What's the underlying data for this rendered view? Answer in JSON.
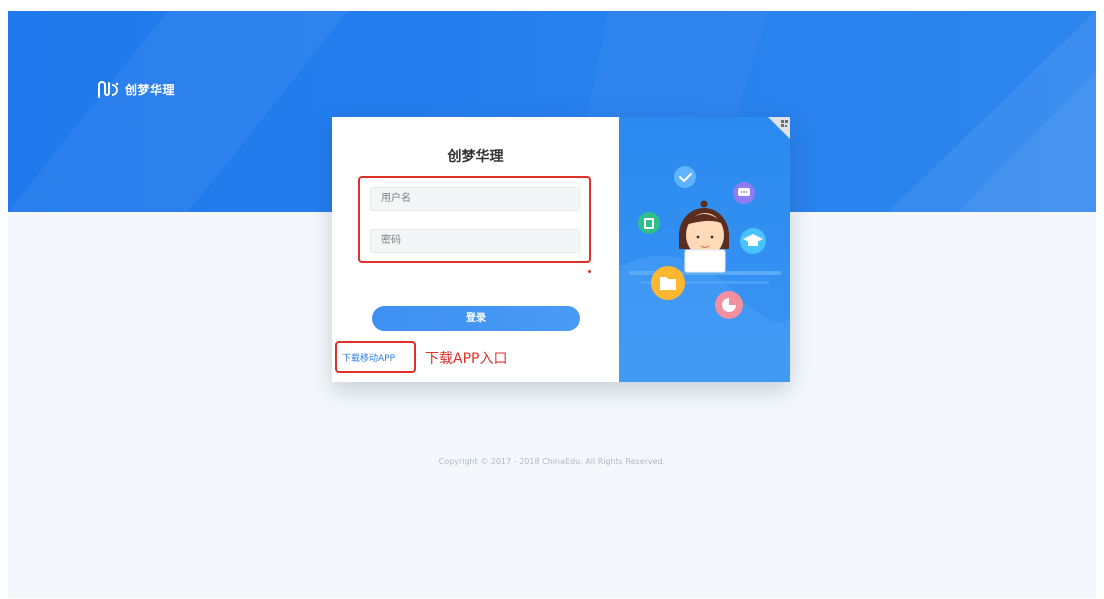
{
  "header": {
    "logo_text": "创梦华理",
    "logo_icon": "brand-logo-icon"
  },
  "login": {
    "title": "创梦华理",
    "username_placeholder": "用户名",
    "password_placeholder": "密码",
    "login_button": "登录",
    "download_link": "下载移动APP",
    "qr_icon": "qr-code-icon"
  },
  "annotation": {
    "text": "下载APP入口",
    "color": "#e0302a"
  },
  "footer": {
    "copyright": "Copyright © 2017 - 2018 ChinaEdu. All Rights Reserved."
  },
  "colors": {
    "banner": "#1f79ec",
    "accent": "#3d8ff2",
    "illustration_bg": "#2b8af0"
  },
  "illustration": {
    "icons": [
      "check-icon",
      "chat-icon",
      "book-icon",
      "graduation-cap-icon",
      "folder-icon",
      "pie-chart-icon"
    ]
  }
}
